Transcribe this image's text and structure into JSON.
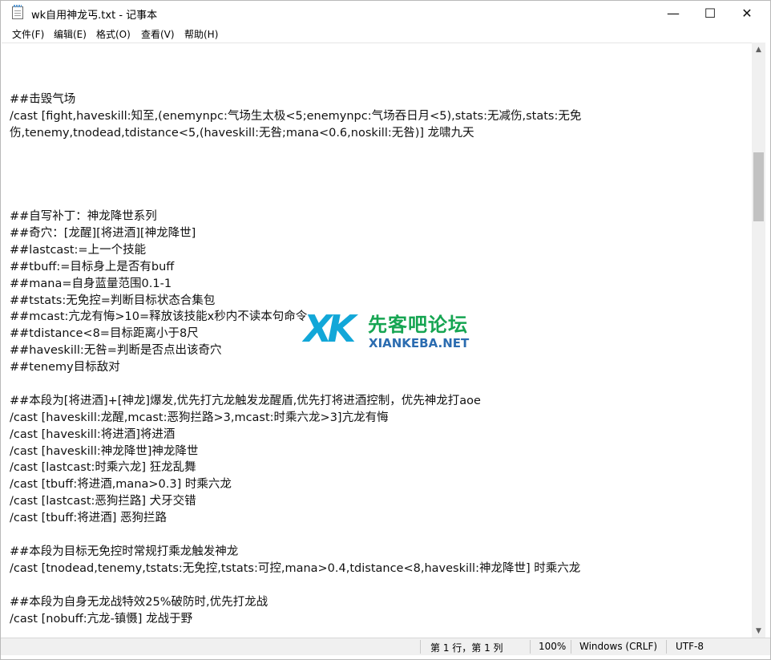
{
  "window": {
    "title": "wk自用神龙丐.txt - 记事本",
    "minimize_glyph": "—",
    "maximize_glyph": "☐",
    "close_glyph": "✕"
  },
  "menu": {
    "items": [
      "文件(F)",
      "编辑(E)",
      "格式(O)",
      "查看(V)",
      "帮助(H)"
    ]
  },
  "editor": {
    "lines": [
      "",
      "##击毁气场",
      "/cast [fight,haveskill:知至,(enemynpc:气场生太极<5;enemynpc:气场吞日月<5),stats:无减伤,stats:无免",
      "伤,tenemy,tnodead,tdistance<5,(haveskill:无咎;mana<0.6,noskill:无咎)] 龙啸九天",
      "",
      "",
      "",
      "",
      "##自写补丁：神龙降世系列",
      "##奇穴：[龙醒][将进酒][神龙降世]",
      "##lastcast:=上一个技能",
      "##tbuff:=目标身上是否有buff",
      "##mana=自身蓝量范围0.1-1",
      "##tstats:无免控=判断目标状态合集包",
      "##mcast:亢龙有悔>10=释放该技能x秒内不读本句命令",
      "##tdistance<8=目标距离小于8尺",
      "##haveskill:无咎=判断是否点出该奇穴",
      "##tenemy目标敌对",
      "",
      "##本段为[将进酒]+[神龙]爆发,优先打亢龙触发龙醒盾,优先打将进酒控制，优先神龙打aoe",
      "/cast [haveskill:龙醒,mcast:恶狗拦路>3,mcast:时乘六龙>3]亢龙有悔",
      "/cast [haveskill:将进酒]将进酒",
      "/cast [haveskill:神龙降世]神龙降世",
      "/cast [lastcast:时乘六龙] 狂龙乱舞",
      "/cast [tbuff:将进酒,mana>0.3] 时乘六龙",
      "/cast [lastcast:恶狗拦路] 犬牙交错",
      "/cast [tbuff:将进酒] 恶狗拦路",
      "",
      "##本段为目标无免控时常规打乘龙触发神龙",
      "/cast [tnodead,tenemy,tstats:无免控,tstats:可控,mana>0.4,tdistance<8,haveskill:神龙降世] 时乘六龙",
      "",
      "##本段为自身无龙战特效25%破防时,优先打龙战",
      "/cast [nobuff:亢龙-镇慑] 龙战于野"
    ]
  },
  "watermark": {
    "logo_text": "XK",
    "name_cn": "先客吧论坛",
    "name_en": "XIANKEBA.NET"
  },
  "scrollbar": {
    "up_glyph": "▲",
    "down_glyph": "▼"
  },
  "status": {
    "position": "第 1 行，第 1 列",
    "zoom": "100%",
    "line_ending": "Windows (CRLF)",
    "encoding": "UTF-8"
  }
}
